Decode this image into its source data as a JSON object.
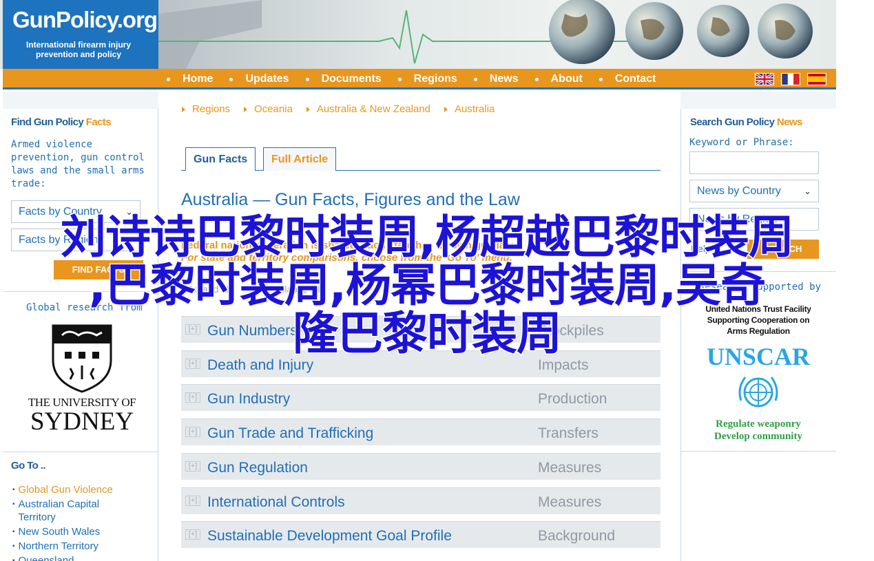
{
  "logo": {
    "brand": "GunPolicy.org",
    "tagline_1": "International firearm injury",
    "tagline_2": "prevention and policy"
  },
  "nav": {
    "items": [
      "Home",
      "Updates",
      "Documents",
      "Regions",
      "News",
      "About",
      "Contact"
    ]
  },
  "flags": [
    "uk-flag-icon",
    "france-flag-icon",
    "spain-flag-icon"
  ],
  "left": {
    "title_a": "Find Gun Policy ",
    "title_b": "Facts",
    "desc": "Armed violence prevention, gun control laws and the small arms trade:",
    "select_country": "Facts by Country",
    "select_region": "Facts by Region",
    "find_button": "FIND FACTS",
    "research_text": "Global research from",
    "uni_line1": "THE UNIVERSITY OF",
    "uni_line2": "SYDNEY",
    "goto_title": "Go To ..",
    "goto_items": [
      "Global Gun Violence",
      "Australian Capital Territory",
      "New South Wales",
      "Northern Territory",
      "Queensland"
    ]
  },
  "breadcrumb": [
    "Regions",
    "Oceania",
    "Australia & New Zealand",
    "Australia"
  ],
  "tabs": {
    "gun_facts": "Gun Facts",
    "full_article": "Full Article"
  },
  "main": {
    "title": "Australia — Gun Facts, Figures and the Law",
    "notice_1": "Federal nation: federation is shared, each state has its own gun law",
    "notice_2": "For state and territory comparisons, choose from the 'Go To' menu.",
    "expand_all": "Expand all",
    "collapse_all": "collapse all",
    "sections": [
      {
        "name": "Gun Numbers",
        "sub": "Stockpiles"
      },
      {
        "name": "Death and Injury",
        "sub": "Impacts"
      },
      {
        "name": "Gun Industry",
        "sub": "Production"
      },
      {
        "name": "Gun Trade and Trafficking",
        "sub": "Transfers"
      },
      {
        "name": "Gun Regulation",
        "sub": "Measures"
      },
      {
        "name": "International Controls",
        "sub": "Measures"
      },
      {
        "name": "Sustainable Development Goal Profile",
        "sub": "Background"
      }
    ]
  },
  "right": {
    "title_a": "Search Gun Policy ",
    "title_b": "News",
    "keyword_label": "Keyword or Phrase:",
    "select_country": "News by Country",
    "select_region": "News by Region",
    "help": "Help",
    "search_button": "SEARCH",
    "supported": "Research supported by",
    "unscar_1": "United Nations Trust Facility",
    "unscar_2": "Supporting Cooperation on",
    "unscar_3": "Arms Regulation",
    "unscar_name": "UNSCAR",
    "unscar_tag_1": "Regulate weaponry",
    "unscar_tag_2": "Develop community"
  },
  "overlay": {
    "line1": "刘诗诗巴黎时装周,杨超越巴黎时装周",
    "line2": ",巴黎时装周,杨幂巴黎时装周,吴奇",
    "line3": "隆巴黎时装周"
  }
}
